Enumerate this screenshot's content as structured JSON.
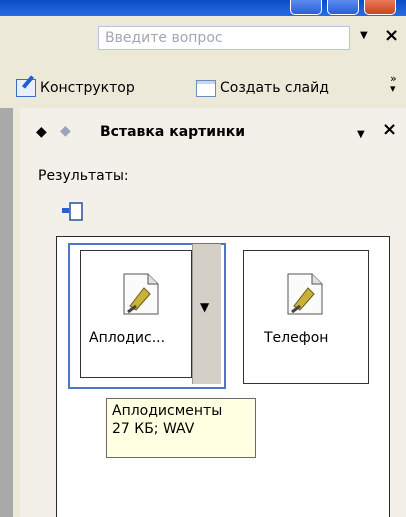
{
  "menubar": {
    "help_placeholder": "Введите вопрос"
  },
  "toolbar": {
    "designer_label": "Конструктор",
    "new_slide_label": "Создать слайд",
    "more_glyph": "»"
  },
  "task_pane": {
    "title": "Вставка картинки",
    "results_label": "Результаты:",
    "results": [
      {
        "label": "Аплодис...",
        "icon": "sound-file-icon",
        "selected": true
      },
      {
        "label": "Телефон",
        "icon": "sound-file-icon",
        "selected": false
      }
    ],
    "tooltip": {
      "line1": "Аплодисменты",
      "line2": "27 КБ; WAV"
    }
  },
  "colors": {
    "title_blue": "#0A4EC8",
    "tooltip_bg": "#FFFFE1",
    "selection": "#4A78C8"
  }
}
